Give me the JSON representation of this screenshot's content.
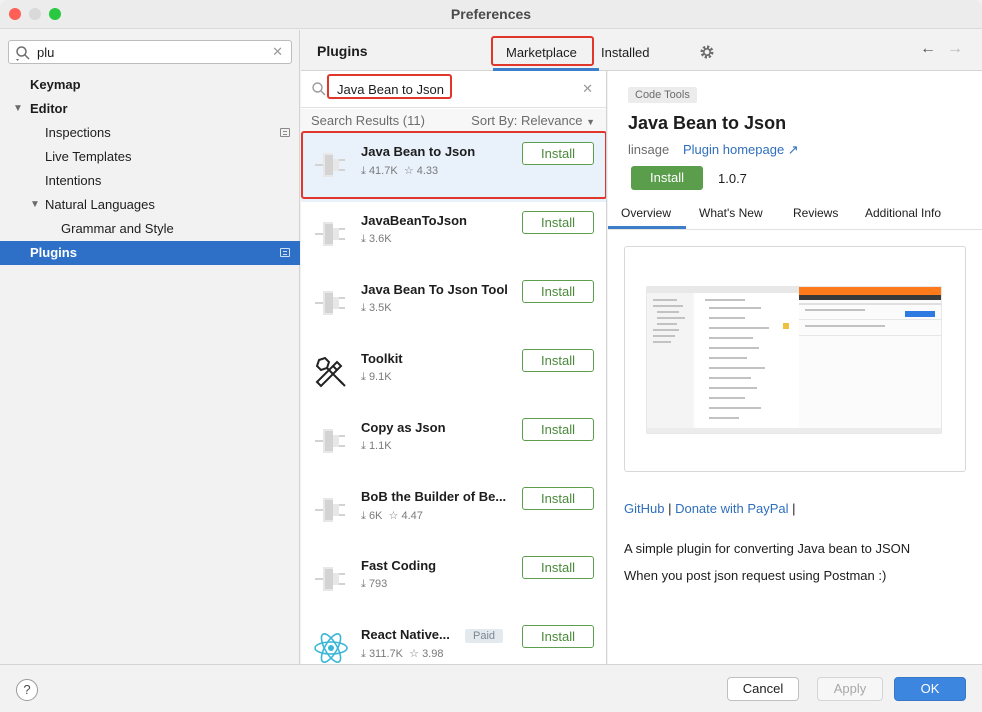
{
  "window": {
    "title": "Preferences"
  },
  "sidebar": {
    "search_value": "plu",
    "items": [
      {
        "label": "Keymap"
      },
      {
        "label": "Editor"
      },
      {
        "label": "Inspections"
      },
      {
        "label": "Live Templates"
      },
      {
        "label": "Intentions"
      },
      {
        "label": "Natural Languages"
      },
      {
        "label": "Grammar and Style"
      },
      {
        "label": "Plugins"
      }
    ]
  },
  "header": {
    "title": "Plugins",
    "tabs": [
      {
        "label": "Marketplace"
      },
      {
        "label": "Installed"
      }
    ]
  },
  "list": {
    "search_value": "Java Bean to Json",
    "results_label": "Search Results (11)",
    "sort_label": "Sort By: Relevance",
    "install_label": "Install",
    "items": [
      {
        "name": "Java Bean to Json",
        "downloads": "41.7K",
        "rating": "4.33"
      },
      {
        "name": "JavaBeanToJson",
        "downloads": "3.6K"
      },
      {
        "name": "Java Bean To Json Tool",
        "downloads": "3.5K"
      },
      {
        "name": "Toolkit",
        "downloads": "9.1K"
      },
      {
        "name": "Copy as Json",
        "downloads": "1.1K"
      },
      {
        "name": "BoB the Builder of Be...",
        "downloads": "6K",
        "rating": "4.47"
      },
      {
        "name": "Fast Coding",
        "downloads": "793"
      },
      {
        "name": "React Native...",
        "downloads": "311.7K",
        "rating": "3.98",
        "badge": "Paid"
      }
    ]
  },
  "detail": {
    "category": "Code Tools",
    "name": "Java Bean to Json",
    "vendor": "linsage",
    "homepage_label": "Plugin homepage ↗",
    "install_label": "Install",
    "version": "1.0.7",
    "tabs": [
      {
        "label": "Overview"
      },
      {
        "label": "What's New"
      },
      {
        "label": "Reviews"
      },
      {
        "label": "Additional Info"
      }
    ],
    "link_github": "GitHub",
    "link_sep": " | ",
    "link_paypal": "Donate with PayPal",
    "link_tail": " |",
    "description_1": "A simple plugin for converting Java bean to JSON",
    "description_2": "When you post json request using Postman :)"
  },
  "footer": {
    "help_label": "?",
    "cancel_label": "Cancel",
    "apply_label": "Apply",
    "ok_label": "OK"
  },
  "colors": {
    "accent": "#2e70c8",
    "install_green": "#5a9d4b",
    "highlight_red": "#e0362c"
  }
}
